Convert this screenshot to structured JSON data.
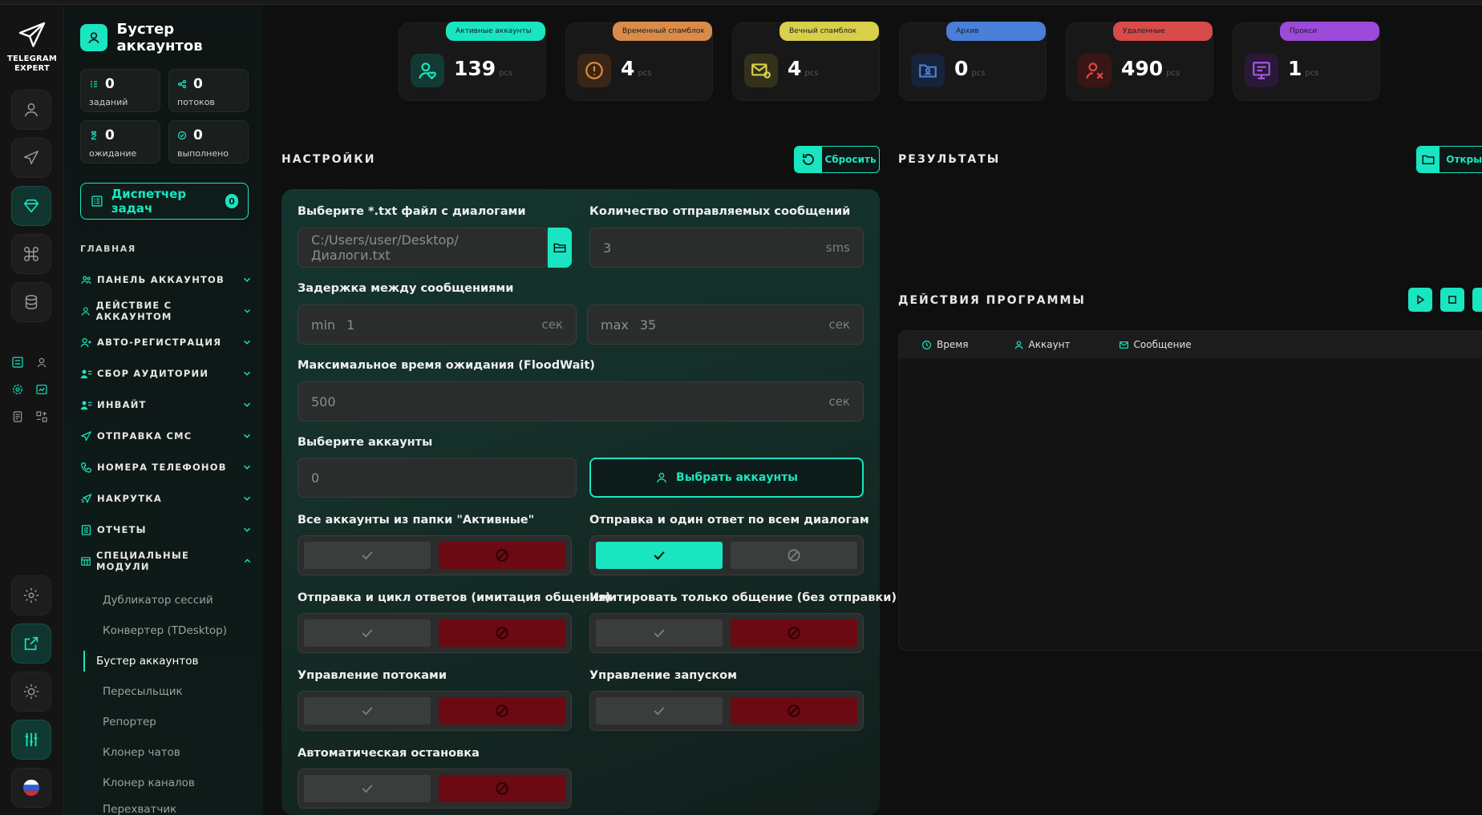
{
  "app": {
    "logo_line1": "TELEGRAM",
    "logo_line2": "EXPERT"
  },
  "sidebar": {
    "title": "Бустер аккаунтов",
    "stats": [
      {
        "value": "0",
        "label": "заданий"
      },
      {
        "value": "0",
        "label": "потоков"
      },
      {
        "value": "0",
        "label": "ожидание"
      },
      {
        "value": "0",
        "label": "выполнено"
      }
    ],
    "dispatcher": {
      "label": "Диспетчер задач",
      "count": "0"
    },
    "section": "ГЛАВНАЯ",
    "menu": [
      {
        "label": "ПАНЕЛЬ АККАУНТОВ"
      },
      {
        "label": "ДЕЙСТВИЕ С АККАУНТОМ"
      },
      {
        "label": "АВТО-РЕГИСТРАЦИЯ"
      },
      {
        "label": "СБОР АУДИТОРИИ"
      },
      {
        "label": "ИНВАЙТ"
      },
      {
        "label": "ОТПРАВКА СМС"
      },
      {
        "label": "НОМЕРА ТЕЛЕФОНОВ"
      },
      {
        "label": "НАКРУТКА"
      },
      {
        "label": "ОТЧЕТЫ"
      },
      {
        "label": "СПЕЦИАЛЬНЫЕ МОДУЛИ"
      }
    ],
    "submenu": [
      {
        "label": "Дубликатор сессий"
      },
      {
        "label": "Конвертер (TDesktop)"
      },
      {
        "label": "Бустер аккаунтов"
      },
      {
        "label": "Пересыльщик"
      },
      {
        "label": "Репортер"
      },
      {
        "label": "Клонер чатов"
      },
      {
        "label": "Клонер каналов"
      },
      {
        "label": "Перехватчик"
      }
    ]
  },
  "cards": [
    {
      "label": "Активные аккаунты",
      "value": "139",
      "unit": "pcs",
      "color": "#19e6c1"
    },
    {
      "label": "Временный спамблок",
      "value": "4",
      "unit": "pcs",
      "color": "#d98b4a"
    },
    {
      "label": "Вечный спамблок",
      "value": "4",
      "unit": "pcs",
      "color": "#d8cf4a"
    },
    {
      "label": "Архив",
      "value": "0",
      "unit": "pcs",
      "color": "#4a7fd9"
    },
    {
      "label": "Удаленные",
      "value": "490",
      "unit": "pcs",
      "color": "#d94a4a"
    },
    {
      "label": "Прокси",
      "value": "1",
      "unit": "pcs",
      "color": "#9b4ad9"
    }
  ],
  "settings": {
    "heading": "НАСТРОЙКИ",
    "reset_label": "Сбросить",
    "file_label": "Выберите *.txt файл с диалогами",
    "file_placeholder": "C:/Users/user/Desktop/Диалоги.txt",
    "count_label": "Количество отправляемых сообщений",
    "count_value": "3",
    "count_unit": "sms",
    "delay_label": "Задержка между сообщениями",
    "delay_min_prefix": "min",
    "delay_min": "1",
    "delay_max_prefix": "max",
    "delay_max": "35",
    "sec_unit": "сек",
    "flood_label": "Максимальное время ожидания (FloodWait)",
    "flood_value": "500",
    "accounts_label": "Выберите аккаунты",
    "accounts_value": "0",
    "select_accounts": "Выбрать аккаунты",
    "toggles": [
      {
        "label": "Все аккаунты из папки \"Активные\"",
        "state": "off"
      },
      {
        "label": "Отправка и один ответ по всем диалогам",
        "state": "on"
      },
      {
        "label": "Отправка и цикл ответов (имитация общения)",
        "state": "off"
      },
      {
        "label": "Имитировать только общение (без отправки)",
        "state": "off"
      },
      {
        "label": "Управление потоками",
        "state": "off"
      },
      {
        "label": "Управление запуском",
        "state": "off"
      },
      {
        "label": "Автоматическая остановка",
        "state": "off"
      }
    ]
  },
  "results": {
    "heading": "РЕЗУЛЬТАТЫ",
    "open_label": "Открыт"
  },
  "actions": {
    "heading": "ДЕЙСТВИЯ ПРОГРАММЫ",
    "columns": [
      "Время",
      "Аккаунт",
      "Сообщение"
    ]
  }
}
